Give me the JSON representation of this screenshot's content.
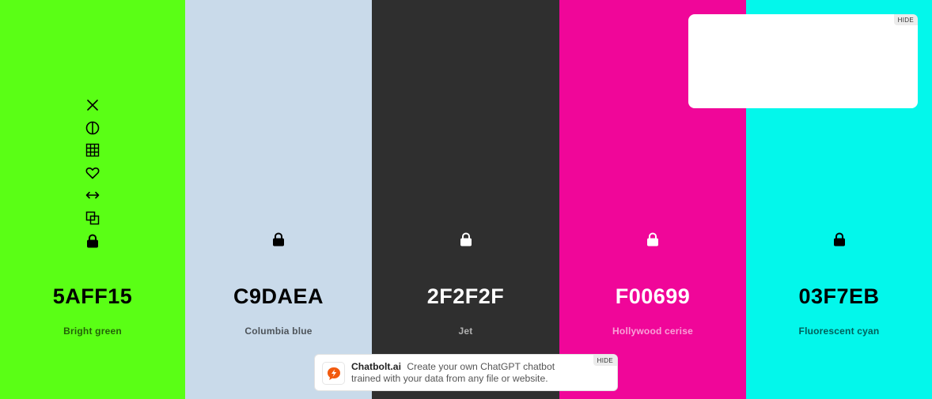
{
  "colors": [
    {
      "hex": "5AFF15",
      "name": "Bright green",
      "bg": "#5AFF15",
      "fg": "#000000"
    },
    {
      "hex": "C9DAEA",
      "name": "Columbia blue",
      "bg": "#C9DAEA",
      "fg": "#000000"
    },
    {
      "hex": "2F2F2F",
      "name": "Jet",
      "bg": "#2F2F2F",
      "fg": "#FFFFFF"
    },
    {
      "hex": "F00699",
      "name": "Hollywood cerise",
      "bg": "#F00699",
      "fg": "#FFFFFF"
    },
    {
      "hex": "03F7EB",
      "name": "Fluorescent cyan",
      "bg": "#03F7EB",
      "fg": "#000000"
    }
  ],
  "tools": [
    "close-icon",
    "contrast-icon",
    "shades-grid-icon",
    "heart-icon",
    "drag-arrows-icon",
    "copy-icon",
    "lock-icon"
  ],
  "ad": {
    "hide_label": "HIDE"
  },
  "chatbolt": {
    "hide_label": "HIDE",
    "brand": "Chatbolt.ai",
    "text": "Create your own ChatGPT chatbot trained with your data from any file or website.",
    "logo_color": "#F25A0F"
  }
}
